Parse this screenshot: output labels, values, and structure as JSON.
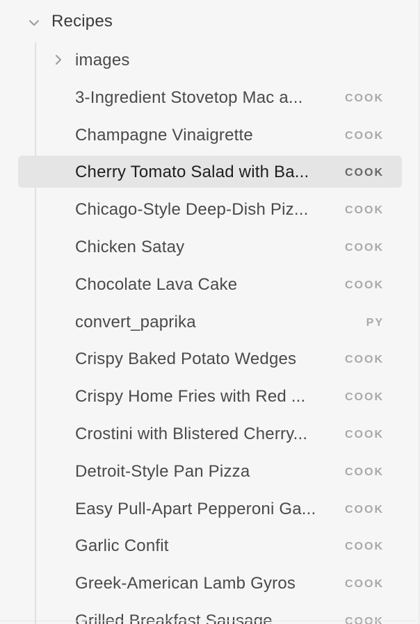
{
  "folder": {
    "label": "Recipes",
    "expanded": true,
    "chevron_icon": "chevron-down-icon"
  },
  "items": [
    {
      "type": "folder",
      "label": "images",
      "ext": "",
      "icon": "chevron-right-icon",
      "selected": false
    },
    {
      "type": "file",
      "label": "3-Ingredient Stovetop Mac a...",
      "ext": "COOK",
      "selected": false
    },
    {
      "type": "file",
      "label": "Champagne Vinaigrette",
      "ext": "COOK",
      "selected": false
    },
    {
      "type": "file",
      "label": "Cherry Tomato Salad with Ba...",
      "ext": "COOK",
      "selected": true
    },
    {
      "type": "file",
      "label": "Chicago-Style Deep-Dish Piz...",
      "ext": "COOK",
      "selected": false
    },
    {
      "type": "file",
      "label": "Chicken Satay",
      "ext": "COOK",
      "selected": false
    },
    {
      "type": "file",
      "label": "Chocolate Lava Cake",
      "ext": "COOK",
      "selected": false
    },
    {
      "type": "file",
      "label": "convert_paprika",
      "ext": "PY",
      "selected": false
    },
    {
      "type": "file",
      "label": "Crispy Baked Potato Wedges",
      "ext": "COOK",
      "selected": false
    },
    {
      "type": "file",
      "label": "Crispy Home Fries with Red ...",
      "ext": "COOK",
      "selected": false
    },
    {
      "type": "file",
      "label": "Crostini with Blistered Cherry...",
      "ext": "COOK",
      "selected": false
    },
    {
      "type": "file",
      "label": "Detroit-Style Pan Pizza",
      "ext": "COOK",
      "selected": false
    },
    {
      "type": "file",
      "label": "Easy Pull-Apart Pepperoni Ga...",
      "ext": "COOK",
      "selected": false
    },
    {
      "type": "file",
      "label": "Garlic Confit",
      "ext": "COOK",
      "selected": false
    },
    {
      "type": "file",
      "label": "Greek-American Lamb Gyros",
      "ext": "COOK",
      "selected": false
    },
    {
      "type": "file",
      "label": "Grilled Breakfast Sausage...",
      "ext": "COOK",
      "selected": false
    }
  ],
  "colors": {
    "background": "#f6f6f6",
    "selected_row": "#e5e5e5",
    "text": "#4a4a4a",
    "ext_badge": "#a9a9a9"
  }
}
